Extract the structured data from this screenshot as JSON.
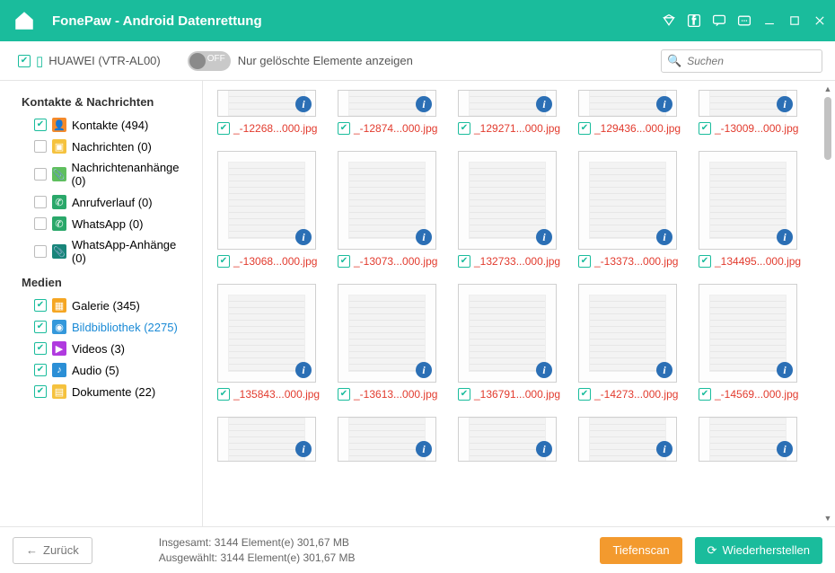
{
  "titlebar": {
    "title": "FonePaw - Android Datenrettung"
  },
  "toprow": {
    "device_name": "HUAWEI (VTR-AL00)",
    "toggle_off": "OFF",
    "toggle_label": "Nur gelöschte Elemente anzeigen",
    "search_placeholder": "Suchen"
  },
  "sidebar": {
    "section1": "Kontakte & Nachrichten",
    "section2": "Medien",
    "items1": [
      {
        "checked": true,
        "icon_bg": "#f58a2a",
        "icon_txt": "👤",
        "label": "Kontakte (494)"
      },
      {
        "checked": false,
        "icon_bg": "#f5c23e",
        "icon_txt": "▣",
        "label": "Nachrichten (0)"
      },
      {
        "checked": false,
        "icon_bg": "#5fbf5e",
        "icon_txt": "📎",
        "label": "Nachrichtenanhänge (0)"
      },
      {
        "checked": false,
        "icon_bg": "#2aa86a",
        "icon_txt": "✆",
        "label": "Anrufverlauf (0)"
      },
      {
        "checked": false,
        "icon_bg": "#2aa86a",
        "icon_txt": "✆",
        "label": "WhatsApp (0)"
      },
      {
        "checked": false,
        "icon_bg": "#18857a",
        "icon_txt": "📎",
        "label": "WhatsApp-Anhänge (0)"
      }
    ],
    "items2": [
      {
        "checked": true,
        "icon_bg": "#f5a623",
        "icon_txt": "▦",
        "label": "Galerie (345)",
        "active": false
      },
      {
        "checked": true,
        "icon_bg": "#3498db",
        "icon_txt": "◉",
        "label": "Bildbibliothek (2275)",
        "active": true
      },
      {
        "checked": true,
        "icon_bg": "#b03adf",
        "icon_txt": "▶",
        "label": "Videos (3)",
        "active": false
      },
      {
        "checked": true,
        "icon_bg": "#2b8fd6",
        "icon_txt": "♪",
        "label": "Audio (5)",
        "active": false
      },
      {
        "checked": true,
        "icon_bg": "#f5c23e",
        "icon_txt": "▤",
        "label": "Dokumente (22)",
        "active": false
      }
    ]
  },
  "grid": {
    "row0": [
      {
        "fn": "_-12268...000.jpg"
      },
      {
        "fn": "_-12874...000.jpg"
      },
      {
        "fn": "_129271...000.jpg"
      },
      {
        "fn": "_129436...000.jpg"
      },
      {
        "fn": "_-13009...000.jpg"
      }
    ],
    "row1": [
      {
        "fn": "_-13068...000.jpg"
      },
      {
        "fn": "_-13073...000.jpg"
      },
      {
        "fn": "_132733...000.jpg"
      },
      {
        "fn": "_-13373...000.jpg"
      },
      {
        "fn": "_134495...000.jpg"
      }
    ],
    "row2": [
      {
        "fn": "_135843...000.jpg"
      },
      {
        "fn": "_-13613...000.jpg"
      },
      {
        "fn": "_136791...000.jpg"
      },
      {
        "fn": "_-14273...000.jpg"
      },
      {
        "fn": "_-14569...000.jpg"
      }
    ]
  },
  "footer": {
    "back": "Zurück",
    "total_line": "Insgesamt: 3144 Element(e) 301,67 MB",
    "selected_line": "Ausgewählt: 3144 Element(e) 301,67 MB",
    "deepscan": "Tiefenscan",
    "recover": "Wiederherstellen"
  }
}
